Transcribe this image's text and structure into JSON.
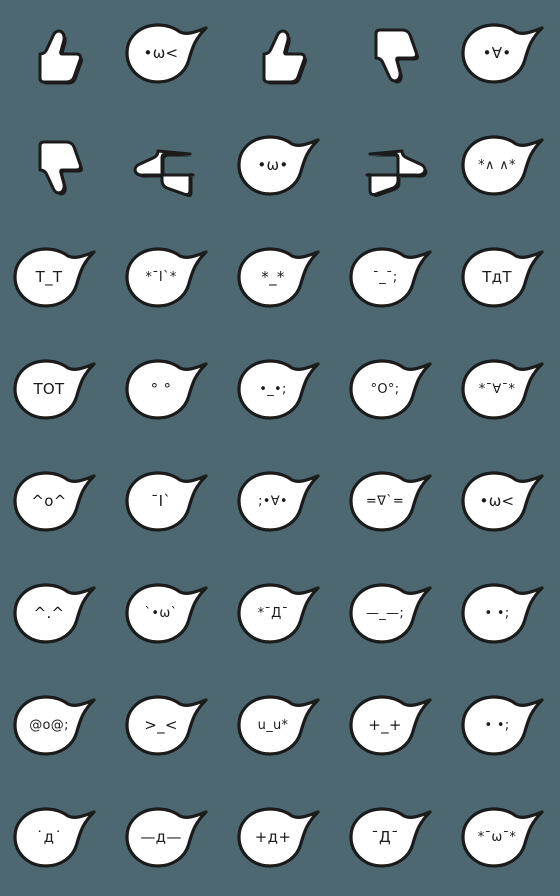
{
  "sheet": {
    "background_color": "#4d6870",
    "sticker_fill": "#ffffff",
    "sticker_outline": "#1b1b1b",
    "columns": 5,
    "rows": 8,
    "total_stickers": 40
  },
  "stickers": [
    {
      "index": 1,
      "row": 1,
      "col": 1,
      "type": "hand",
      "icon": "thumbs-up-icon",
      "name": "thumbs-up",
      "face": ""
    },
    {
      "index": 2,
      "row": 1,
      "col": 2,
      "type": "face",
      "icon": "blob-face-icon",
      "name": "face-dot-omega-less",
      "face": "•ω<"
    },
    {
      "index": 3,
      "row": 1,
      "col": 3,
      "type": "hand",
      "icon": "thumbs-up-icon",
      "name": "thumbs-up",
      "face": ""
    },
    {
      "index": 4,
      "row": 1,
      "col": 4,
      "type": "hand",
      "icon": "thumbs-down-icon",
      "name": "thumbs-down",
      "face": ""
    },
    {
      "index": 5,
      "row": 1,
      "col": 5,
      "type": "face",
      "icon": "blob-face-icon",
      "name": "face-dot-forall-dot",
      "face": "•∀•"
    },
    {
      "index": 6,
      "row": 2,
      "col": 1,
      "type": "hand",
      "icon": "thumbs-down-icon",
      "name": "thumbs-down",
      "face": ""
    },
    {
      "index": 7,
      "row": 2,
      "col": 2,
      "type": "hand",
      "icon": "point-left-icon",
      "name": "pointing-left",
      "face": ""
    },
    {
      "index": 8,
      "row": 2,
      "col": 3,
      "type": "face",
      "icon": "blob-face-icon",
      "name": "face-dot-omega-dot",
      "face": "•ω•"
    },
    {
      "index": 9,
      "row": 2,
      "col": 4,
      "type": "hand",
      "icon": "point-right-icon",
      "name": "pointing-right",
      "face": ""
    },
    {
      "index": 10,
      "row": 2,
      "col": 5,
      "type": "face",
      "icon": "blob-face-icon",
      "name": "face-star-caret",
      "face": "*∧ ∧*"
    },
    {
      "index": 11,
      "row": 3,
      "col": 1,
      "type": "face",
      "icon": "blob-face-icon",
      "name": "face-t-underscore-t",
      "face": "T_T"
    },
    {
      "index": 12,
      "row": 3,
      "col": 2,
      "type": "face",
      "icon": "blob-face-icon",
      "name": "face-star-i-star",
      "face": "*ˉI`*"
    },
    {
      "index": 13,
      "row": 3,
      "col": 3,
      "type": "face",
      "icon": "blob-face-icon",
      "name": "face-star-underscore",
      "face": "*_*"
    },
    {
      "index": 14,
      "row": 3,
      "col": 4,
      "type": "face",
      "icon": "blob-face-icon",
      "name": "face-dash-underscore",
      "face": "ˉ_ˉ;"
    },
    {
      "index": 15,
      "row": 3,
      "col": 5,
      "type": "face",
      "icon": "blob-face-icon",
      "name": "face-t-de-t",
      "face": "ТдТ"
    },
    {
      "index": 16,
      "row": 4,
      "col": 1,
      "type": "face",
      "icon": "blob-face-icon",
      "name": "face-tot",
      "face": "ТOТ"
    },
    {
      "index": 17,
      "row": 4,
      "col": 2,
      "type": "face",
      "icon": "blob-face-icon",
      "name": "face-circle-eyes",
      "face": "° °"
    },
    {
      "index": 18,
      "row": 4,
      "col": 3,
      "type": "face",
      "icon": "blob-face-icon",
      "name": "face-dot-underscore",
      "face": "•_•;"
    },
    {
      "index": 19,
      "row": 4,
      "col": 4,
      "type": "face",
      "icon": "blob-face-icon",
      "name": "face-big-o",
      "face": "°O°;"
    },
    {
      "index": 20,
      "row": 4,
      "col": 5,
      "type": "face",
      "icon": "blob-face-icon",
      "name": "face-star-forall",
      "face": "*ˉ∀ˉ*"
    },
    {
      "index": 21,
      "row": 5,
      "col": 1,
      "type": "face",
      "icon": "blob-face-icon",
      "name": "face-caret-o-caret",
      "face": "^o^"
    },
    {
      "index": 22,
      "row": 5,
      "col": 2,
      "type": "face",
      "icon": "blob-face-icon",
      "name": "face-dash-i-dash",
      "face": "ˉI`"
    },
    {
      "index": 23,
      "row": 5,
      "col": 3,
      "type": "face",
      "icon": "blob-face-icon",
      "name": "face-semicolon-forall",
      "face": ";•∀•"
    },
    {
      "index": 24,
      "row": 5,
      "col": 4,
      "type": "face",
      "icon": "blob-face-icon",
      "name": "face-equals-nabla",
      "face": "=∇`="
    },
    {
      "index": 25,
      "row": 5,
      "col": 5,
      "type": "face",
      "icon": "blob-face-icon",
      "name": "face-dot-omega-less",
      "face": "•ω<"
    },
    {
      "index": 26,
      "row": 6,
      "col": 1,
      "type": "face",
      "icon": "blob-face-icon",
      "name": "face-caret-dot-caret",
      "face": "^.^"
    },
    {
      "index": 27,
      "row": 6,
      "col": 2,
      "type": "face",
      "icon": "blob-face-icon",
      "name": "face-tick-omega",
      "face": "`•ω`"
    },
    {
      "index": 28,
      "row": 6,
      "col": 3,
      "type": "face",
      "icon": "blob-face-icon",
      "name": "face-star-de",
      "face": "*ˉДˉ"
    },
    {
      "index": 29,
      "row": 6,
      "col": 4,
      "type": "face",
      "icon": "blob-face-icon",
      "name": "face-flat-eyes",
      "face": "—_—;"
    },
    {
      "index": 30,
      "row": 6,
      "col": 5,
      "type": "face",
      "icon": "blob-face-icon",
      "name": "face-two-dots",
      "face": "• •;"
    },
    {
      "index": 31,
      "row": 7,
      "col": 1,
      "type": "face",
      "icon": "blob-face-icon",
      "name": "face-at-o-at",
      "face": "@o@;"
    },
    {
      "index": 32,
      "row": 7,
      "col": 2,
      "type": "face",
      "icon": "blob-face-icon",
      "name": "face-greater-less",
      "face": ">_<"
    },
    {
      "index": 33,
      "row": 7,
      "col": 3,
      "type": "face",
      "icon": "blob-face-icon",
      "name": "face-u-underscore-u",
      "face": "u_u*"
    },
    {
      "index": 34,
      "row": 7,
      "col": 4,
      "type": "face",
      "icon": "blob-face-icon",
      "name": "face-plus-underscore",
      "face": "+_+"
    },
    {
      "index": 35,
      "row": 7,
      "col": 5,
      "type": "face",
      "icon": "blob-face-icon",
      "name": "face-dots-sweat",
      "face": "• •;"
    },
    {
      "index": 36,
      "row": 8,
      "col": 1,
      "type": "face",
      "icon": "blob-face-icon",
      "name": "face-dot-de",
      "face": "˙д˙"
    },
    {
      "index": 37,
      "row": 8,
      "col": 2,
      "type": "face",
      "icon": "blob-face-icon",
      "name": "face-flat-de",
      "face": "—д—"
    },
    {
      "index": 38,
      "row": 8,
      "col": 3,
      "type": "face",
      "icon": "blob-face-icon",
      "name": "face-plus-de-plus",
      "face": "+д+"
    },
    {
      "index": 39,
      "row": 8,
      "col": 4,
      "type": "face",
      "icon": "blob-face-icon",
      "name": "face-dash-de-dash",
      "face": "ˉДˉ"
    },
    {
      "index": 40,
      "row": 8,
      "col": 5,
      "type": "face",
      "icon": "blob-face-icon",
      "name": "face-star-omega-star",
      "face": "*ˉωˉ*"
    }
  ]
}
